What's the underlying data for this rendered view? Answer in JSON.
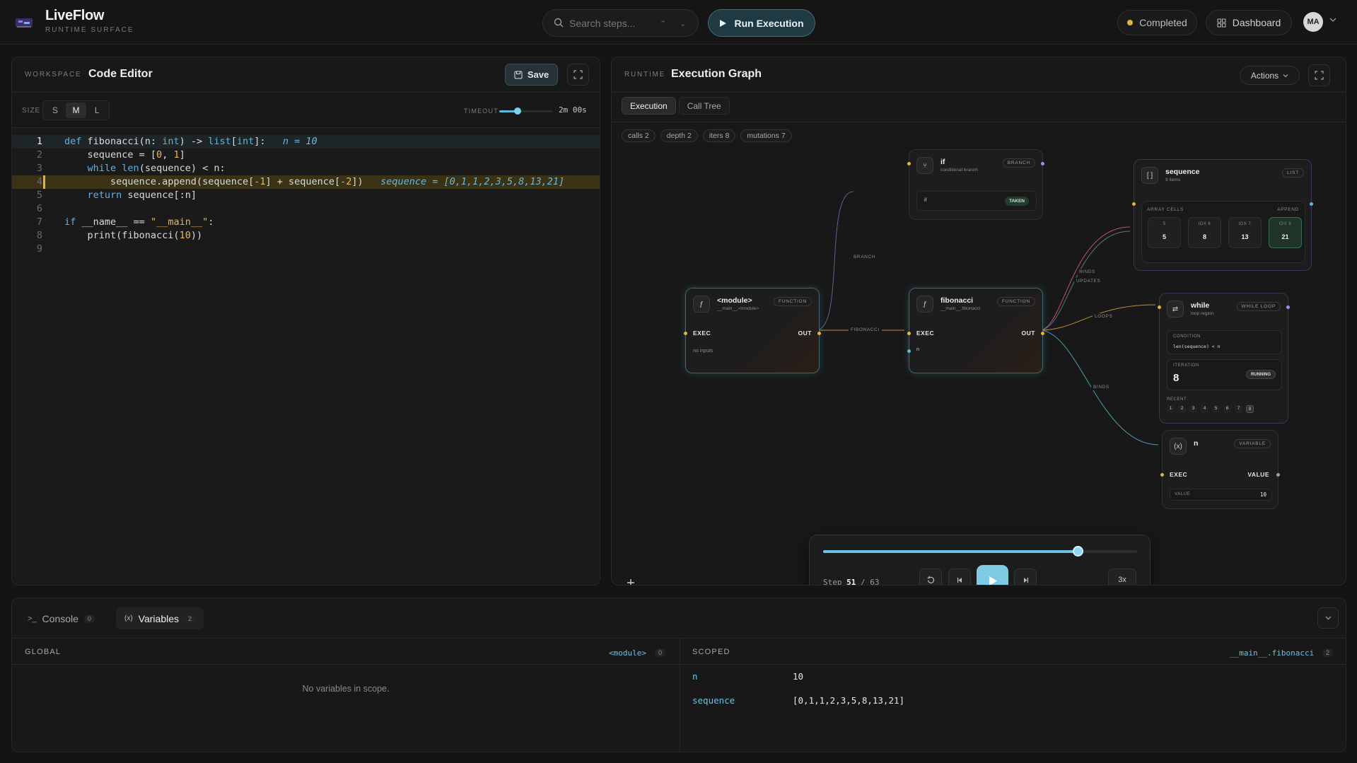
{
  "app": {
    "title": "LiveFlow",
    "subtitle": "RUNTIME SURFACE"
  },
  "topbar": {
    "search_placeholder": "Search steps...",
    "run_label": "Run Execution",
    "status_label": "Completed",
    "status_color": "#e2b23a",
    "dashboard_label": "Dashboard",
    "avatar_initials": "MA"
  },
  "editor": {
    "section": "WORKSPACE",
    "title": "Code Editor",
    "save_label": "Save",
    "size_label": "SIZE",
    "sizes": [
      "S",
      "M",
      "L"
    ],
    "size_selected": "M",
    "timeout_label": "TIMEOUT",
    "timeout_value": "2m 00s",
    "timeout_fraction": 0.35,
    "current_line": 1,
    "highlight_line": 4,
    "lines": [
      {
        "n": "1",
        "html": "<span class='kw'>def</span> fibonacci(n: <span class='ty'>int</span>) -> <span class='ty'>list</span>[<span class='ty'>int</span>]:   <span class='ann'>n = 10</span>"
      },
      {
        "n": "2",
        "html": "    sequence = [<span class='nm'>0</span>, <span class='nm'>1</span>]"
      },
      {
        "n": "3",
        "html": "    <span class='kw'>while</span> <span class='ty'>len</span>(sequence) < n:"
      },
      {
        "n": "4",
        "html": "        sequence.append(sequence[<span class='nm'>-1</span>] + sequence[<span class='nm'>-2</span>])   <span class='ann'>sequence = [0,1,1,2,3,5,8,13,21]</span>"
      },
      {
        "n": "5",
        "html": "    <span class='kw'>return</span> sequence[:n]"
      },
      {
        "n": "6",
        "html": ""
      },
      {
        "n": "7",
        "html": "<span class='kw'>if</span> __name__ == <span class='st'>\"__main__\"</span>:"
      },
      {
        "n": "8",
        "html": "    print(fibonacci(<span class='nm'>10</span>))"
      },
      {
        "n": "9",
        "html": ""
      }
    ]
  },
  "graph": {
    "section": "RUNTIME",
    "title": "Execution Graph",
    "actions_label": "Actions",
    "tabs": [
      "Execution",
      "Call Tree"
    ],
    "chips": [
      "calls 2",
      "depth 2",
      "iters 8",
      "mutations 7"
    ],
    "edge_labels": {
      "branch": "BRANCH",
      "fibonacci": "FIBONACCI",
      "binds": "BINDS",
      "updates": "UPDATES",
      "loops": "LOOPS",
      "binds2": "BINDS"
    },
    "nodes": {
      "module": {
        "title": "<module>",
        "sub": "__main__.<module>",
        "tag": "FUNCTION",
        "exec": "EXEC",
        "out": "OUT",
        "note": "no inputs"
      },
      "fibonacci": {
        "title": "fibonacci",
        "sub": "__main__.fibonacci",
        "tag": "FUNCTION",
        "exec": "EXEC",
        "out": "OUT",
        "param": "n"
      },
      "if": {
        "title": "if",
        "sub": "conditional branch",
        "tag": "BRANCH",
        "cond": "if",
        "badge": "TAKEN"
      },
      "sequence": {
        "title": "sequence",
        "sub": "9 items",
        "tag": "LIST",
        "cells_label": "ARRAY CELLS",
        "append": "APPEND",
        "cells": [
          {
            "idx": "5",
            "val": "5"
          },
          {
            "idx": "IDX 6",
            "val": "8"
          },
          {
            "idx": "IDX 7",
            "val": "13"
          },
          {
            "idx": "IDX 8",
            "val": "21"
          }
        ]
      },
      "while": {
        "title": "while",
        "sub": "loop region",
        "tag": "WHILE LOOP",
        "cond_label": "CONDITION",
        "cond": "len(sequence) < n",
        "iter_label": "ITERATION",
        "iter": "8",
        "badge": "RUNNING",
        "recent_label": "RECENT",
        "recent": [
          "1",
          "2",
          "3",
          "4",
          "5",
          "6",
          "7",
          "8"
        ]
      },
      "n": {
        "title": "n",
        "tag": "VARIABLE",
        "exec": "EXEC",
        "value_port": "VALUE",
        "value_label": "VALUE",
        "value": "10"
      }
    },
    "player": {
      "step_label": "Step",
      "step": "51",
      "total": "63",
      "progress": 0.81,
      "speed": "3x"
    }
  },
  "bottom": {
    "tabs": [
      {
        "label": "Console",
        "count": "0"
      },
      {
        "label": "Variables",
        "count": "2"
      }
    ],
    "global": {
      "label": "GLOBAL",
      "scope": "<module>",
      "count": "0",
      "empty": "No variables in scope."
    },
    "scoped": {
      "label": "SCOPED",
      "scope": "__main__.fibonacci",
      "count": "2",
      "vars": [
        {
          "k": "n",
          "v": "10"
        },
        {
          "k": "sequence",
          "v": "[0,1,1,2,3,5,8,13,21]"
        }
      ]
    }
  }
}
